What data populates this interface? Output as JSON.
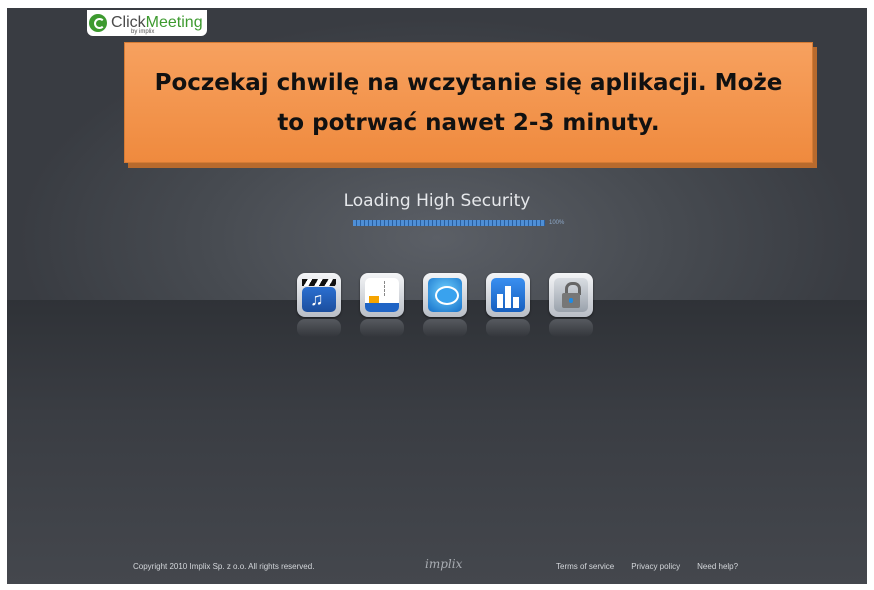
{
  "brand": {
    "name_part1": "Click",
    "name_part2": "Meeting",
    "byline": "by implix"
  },
  "banner": {
    "line1": "Poczekaj chwilę na wczytanie się aplikacji. Może",
    "line2": "to potrwać nawet 2-3 minuty."
  },
  "loading": {
    "title": "Loading High Security",
    "progress_percent": 100,
    "progress_label": "100%"
  },
  "icons": [
    "media-player-icon",
    "whiteboard-icon",
    "chat-icon",
    "statistics-icon",
    "security-lock-icon"
  ],
  "footer": {
    "copyright": "Copyright  2010 Implix Sp. z o.o. All rights reserved.",
    "center_logo": "implix",
    "links": [
      "Terms of service",
      "Privacy policy",
      "Need help?"
    ]
  },
  "colors": {
    "accent_green": "#3d9a2f",
    "banner_orange": "#f19246",
    "progress_blue": "#4f8fd6"
  }
}
